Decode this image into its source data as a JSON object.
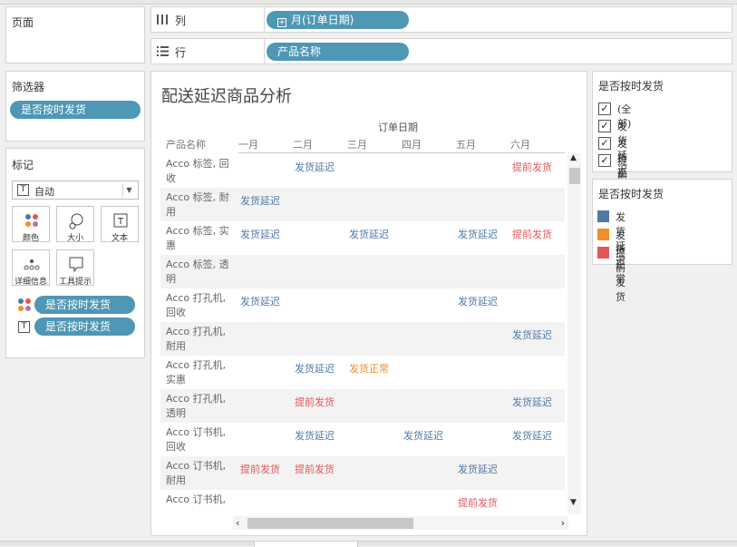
{
  "pages_panel": {
    "title": "页面"
  },
  "filters_panel": {
    "title": "筛选器",
    "pill": "是否按时发货"
  },
  "marks_panel": {
    "title": "标记",
    "mark_type": "自动",
    "mark_type_icon": "text-icon",
    "buttons": [
      {
        "label": "颜色",
        "icon": "color-icon"
      },
      {
        "label": "大小",
        "icon": "size-icon"
      },
      {
        "label": "文本",
        "icon": "text-icon"
      },
      {
        "label": "详细信息",
        "icon": "detail-icon"
      },
      {
        "label": "工具提示",
        "icon": "tooltip-icon"
      }
    ],
    "encodings": [
      {
        "icon": "color-icon",
        "pill": "是否按时发货"
      },
      {
        "icon": "text-icon",
        "pill": "是否按时发货"
      }
    ]
  },
  "columns_shelf": {
    "label": "列",
    "icon": "columns-icon",
    "pill": "月(订单日期)"
  },
  "rows_shelf": {
    "label": "行",
    "icon": "rows-icon",
    "pill": "产品名称"
  },
  "view": {
    "title": "配送延迟商品分析",
    "column_header": "订单日期",
    "row_header": "产品名称",
    "months": [
      "一月",
      "二月",
      "三月",
      "四月",
      "五月",
      "六月"
    ],
    "rows": [
      {
        "product": "Acco 标签, 回收",
        "cells": [
          "",
          "发货延迟",
          "",
          "",
          "",
          "提前发货"
        ]
      },
      {
        "product": "Acco 标签, 耐用",
        "cells": [
          "发货延迟",
          "",
          "",
          "",
          "",
          ""
        ]
      },
      {
        "product": "Acco 标签, 实惠",
        "cells": [
          "发货延迟",
          "",
          "发货延迟",
          "",
          "发货延迟",
          "提前发货"
        ]
      },
      {
        "product": "Acco 标签, 透明",
        "cells": [
          "",
          "",
          "",
          "",
          "",
          ""
        ]
      },
      {
        "product": "Acco 打孔机, 回收",
        "cells": [
          "发货延迟",
          "",
          "",
          "",
          "发货延迟",
          ""
        ]
      },
      {
        "product": "Acco 打孔机, 耐用",
        "cells": [
          "",
          "",
          "",
          "",
          "",
          "发货延迟"
        ]
      },
      {
        "product": "Acco 打孔机, 实惠",
        "cells": [
          "",
          "发货延迟",
          "发货正常",
          "",
          "",
          ""
        ]
      },
      {
        "product": "Acco 打孔机, 透明",
        "cells": [
          "",
          "提前发货",
          "",
          "",
          "",
          "发货延迟"
        ]
      },
      {
        "product": "Acco 订书机, 回收",
        "cells": [
          "",
          "发货延迟",
          "",
          "发货延迟",
          "",
          "发货延迟"
        ]
      },
      {
        "product": "Acco 订书机, 耐用",
        "cells": [
          "提前发货",
          "提前发货",
          "",
          "",
          "发货延迟",
          ""
        ]
      },
      {
        "product": "Acco 订书机, 实惠",
        "cells": [
          "",
          "",
          "",
          "",
          "提前发货",
          ""
        ]
      }
    ]
  },
  "filter_card": {
    "title": "是否按时发货",
    "options": [
      {
        "label": "(全部)",
        "checked": true
      },
      {
        "label": "发货延迟",
        "checked": true
      },
      {
        "label": "发货正常",
        "checked": true
      },
      {
        "label": "提前发货",
        "checked": true
      }
    ]
  },
  "legend_card": {
    "title": "是否按时发货",
    "items": [
      {
        "label": "发货延迟",
        "color": "#4e79a7"
      },
      {
        "label": "发货正常",
        "color": "#f28e2b"
      },
      {
        "label": "提前发货",
        "color": "#e15759"
      }
    ]
  },
  "status_colors": {
    "发货延迟": "#4e79a7",
    "发货正常": "#f28e2b",
    "提前发货": "#e15759"
  }
}
